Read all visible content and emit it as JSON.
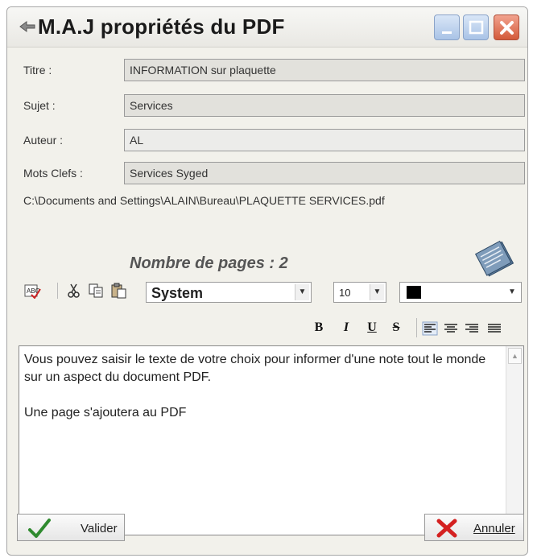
{
  "window": {
    "title": "M.A.J propriétés du PDF"
  },
  "form": {
    "titre_label": "Titre :",
    "titre_value": "INFORMATION  sur plaquette",
    "sujet_label": "Sujet :",
    "sujet_value": "Services",
    "auteur_label": "Auteur :",
    "auteur_value": "AL",
    "mots_label": "Mots Clefs :",
    "mots_value": "Services Syged",
    "path": "C:\\Documents and Settings\\ALAIN\\Bureau\\PLAQUETTE  SERVICES.pdf",
    "pages": "Nombre de pages : 2"
  },
  "toolbar": {
    "font": "System",
    "size": "10",
    "color": "#000000",
    "bold": "B",
    "italic": "I",
    "underline": "U",
    "strike": "S"
  },
  "editor": {
    "line1": "Vous pouvez saisir le texte de votre choix pour informer d'une note tout le monde sur un aspect du document PDF.",
    "line2": "Une page s'ajoutera au PDF"
  },
  "buttons": {
    "valider": "Valider",
    "annuler": "Annuler"
  },
  "icons": {
    "app": "pdf-arrow-icon",
    "document": "document-stack-icon",
    "spell": "spellcheck-icon",
    "cut": "scissors-icon",
    "copy": "copy-icon",
    "paste": "paste-icon",
    "valider": "checkmark-icon",
    "annuler": "red-x-icon"
  }
}
